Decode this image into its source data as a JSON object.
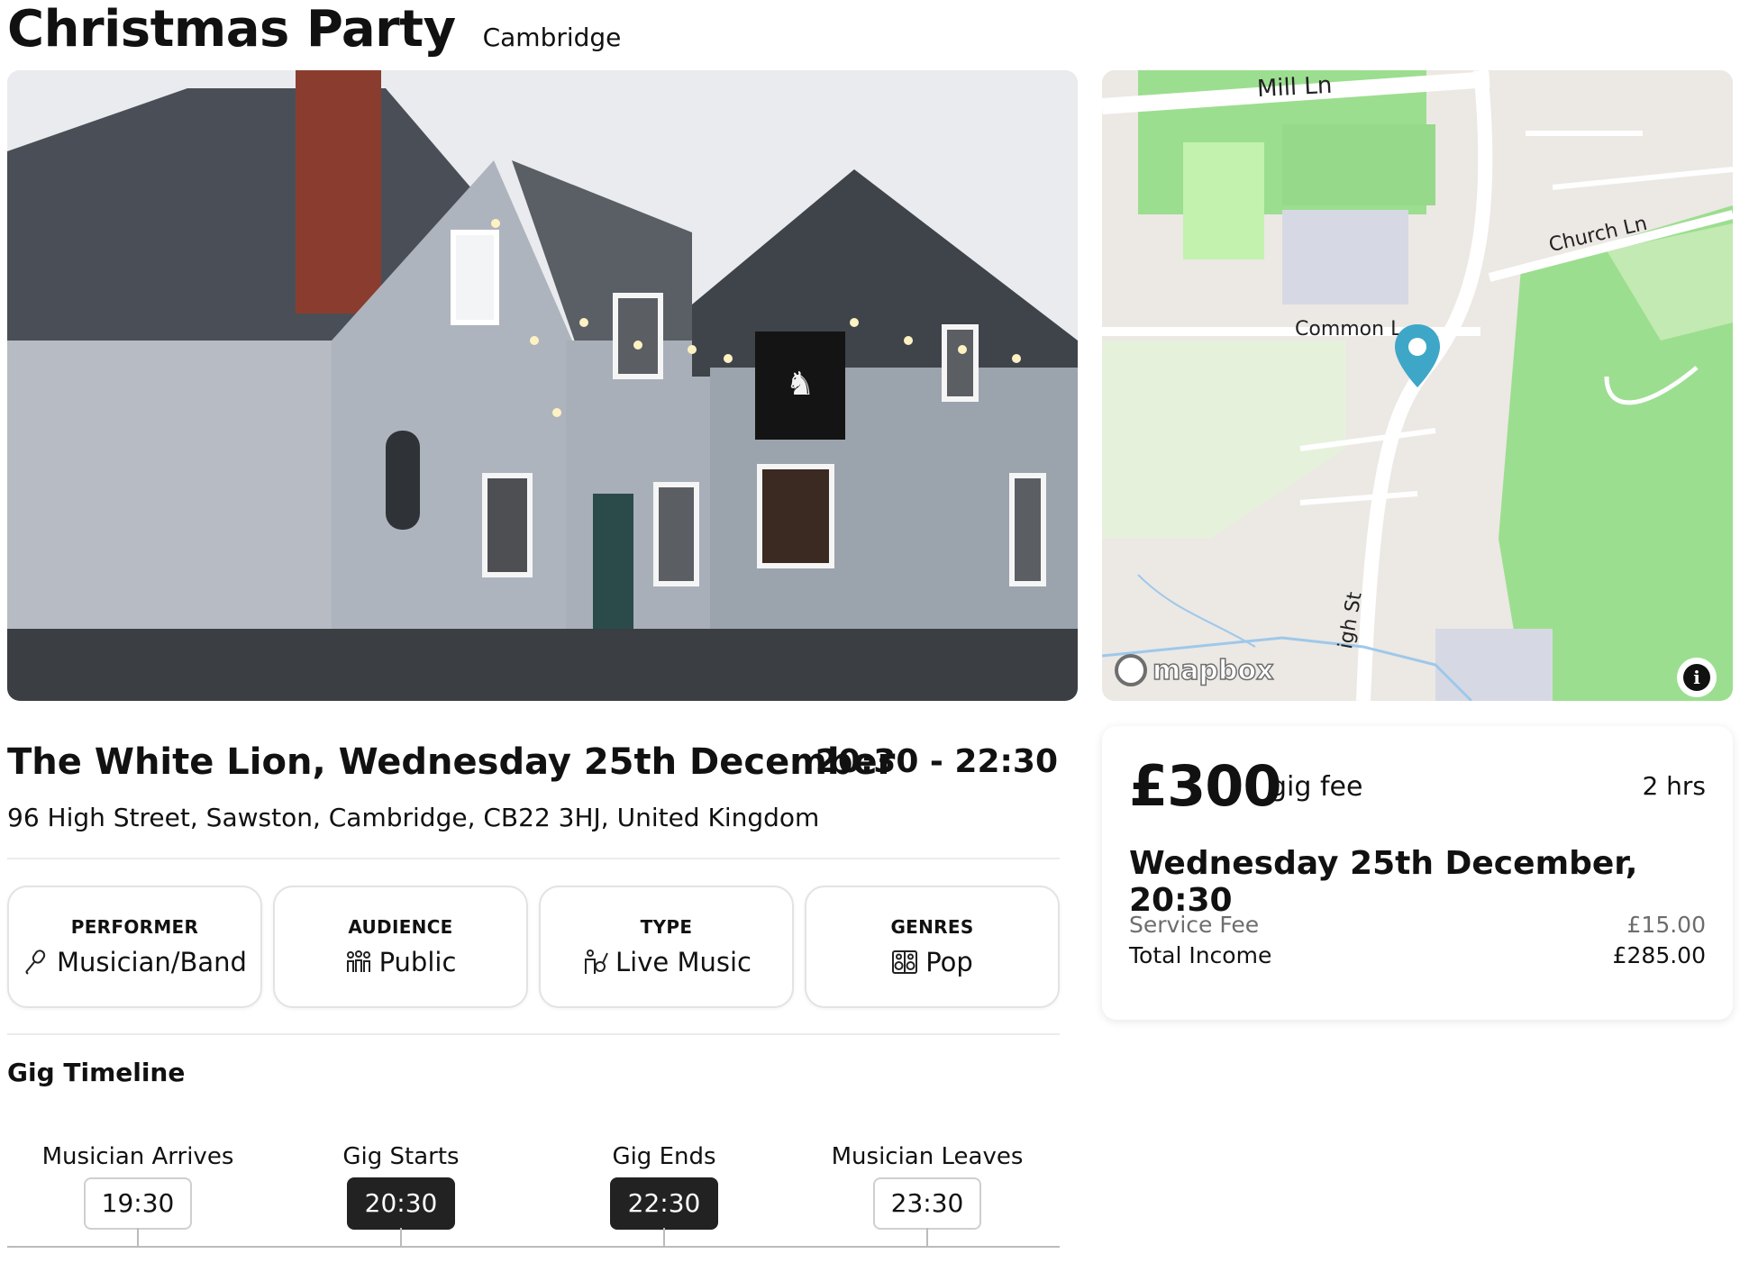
{
  "header": {
    "title": "Christmas Party",
    "location": "Cambridge"
  },
  "map": {
    "streets": [
      "Mill Ln",
      "Church Ln",
      "Common L",
      "igh St"
    ],
    "attribution": "mapbox",
    "info_icon": "info-icon",
    "pin_icon": "location-pin-icon"
  },
  "venue": {
    "title": "The White Lion, Wednesday 25th December",
    "time": "20:30 - 22:30",
    "address": "96 High Street, Sawston, Cambridge, CB22 3HJ, United Kingdom"
  },
  "cards": [
    {
      "label": "PERFORMER",
      "value": "Musician/Band",
      "icon": "microphone-icon"
    },
    {
      "label": "AUDIENCE",
      "value": "Public",
      "icon": "people-icon"
    },
    {
      "label": "TYPE",
      "value": "Live Music",
      "icon": "guitarist-icon"
    },
    {
      "label": "GENRES",
      "value": "Pop",
      "icon": "speaker-icon"
    }
  ],
  "timeline": {
    "title": "Gig Timeline",
    "items": [
      {
        "label": "Musician Arrives",
        "time": "19:30"
      },
      {
        "label": "Gig Starts",
        "time": "20:30"
      },
      {
        "label": "Gig Ends",
        "time": "22:30"
      },
      {
        "label": "Musician Leaves",
        "time": "23:30"
      }
    ]
  },
  "fee": {
    "amount": "£300",
    "label": "gig fee",
    "duration": "2 hrs",
    "date": "Wednesday 25th December, 20:30",
    "service_fee_label": "Service Fee",
    "service_fee_value": "£15.00",
    "total_label": "Total Income",
    "total_value": "£285.00"
  }
}
